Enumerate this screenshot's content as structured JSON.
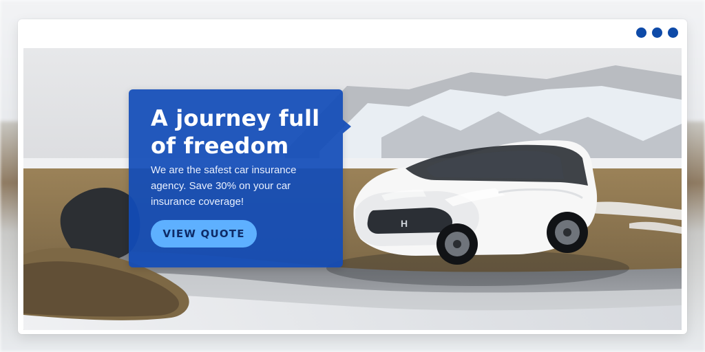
{
  "window": {
    "menu_dots_icon": "more-dots-icon"
  },
  "banner": {
    "headline": "A journey full of freedom",
    "subtext": "We are the safest car insurance agency. Save 30% on your car insurance coverage!",
    "cta_label": "VIEW QUOTE"
  },
  "photo": {
    "car_badge": "H"
  },
  "colors": {
    "accent": "#0e4aa8",
    "card": "#114cb8",
    "button": "#5eb0ff"
  }
}
